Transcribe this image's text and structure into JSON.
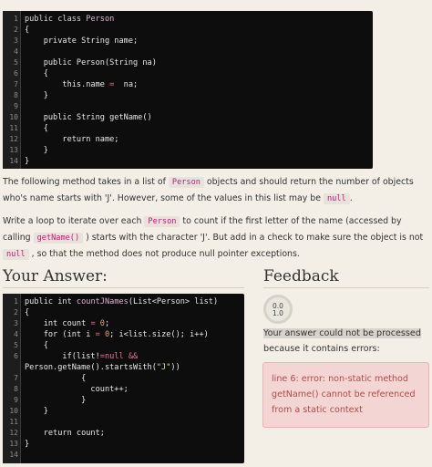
{
  "class_code": {
    "lines": [
      {
        "n": "1",
        "parts": [
          [
            "kw",
            "public class "
          ],
          [
            "cls",
            "Person"
          ]
        ]
      },
      {
        "n": "2",
        "parts": [
          [
            "",
            "{"
          ]
        ]
      },
      {
        "n": "3",
        "parts": [
          [
            "",
            "    private String name;"
          ]
        ]
      },
      {
        "n": "4",
        "parts": [
          [
            "",
            ""
          ]
        ]
      },
      {
        "n": "5",
        "parts": [
          [
            "",
            "    public Person(String na)"
          ]
        ]
      },
      {
        "n": "6",
        "parts": [
          [
            "",
            "    {"
          ]
        ]
      },
      {
        "n": "7",
        "parts": [
          [
            "",
            "        this.name "
          ],
          [
            "op",
            "="
          ],
          [
            "",
            "  na;"
          ]
        ]
      },
      {
        "n": "8",
        "parts": [
          [
            "",
            "    }"
          ]
        ]
      },
      {
        "n": "9",
        "parts": [
          [
            "",
            ""
          ]
        ]
      },
      {
        "n": "10",
        "parts": [
          [
            "",
            "    public String getName()"
          ]
        ]
      },
      {
        "n": "11",
        "parts": [
          [
            "",
            "    {"
          ]
        ]
      },
      {
        "n": "12",
        "parts": [
          [
            "",
            "        return name;"
          ]
        ]
      },
      {
        "n": "13",
        "parts": [
          [
            "",
            "    }"
          ]
        ]
      },
      {
        "n": "14",
        "parts": [
          [
            "",
            "}"
          ]
        ]
      }
    ]
  },
  "instructions": {
    "p1_a": "The following method takes in a list of ",
    "p1_tag1": "Person",
    "p1_b": " objects and should return the number of objects who's name starts with 'J'. However, some of the values in this list may be ",
    "p1_tag2": "null",
    "p1_c": ".",
    "p2_a": "Write a loop to iterate over each ",
    "p2_tag1": "Person",
    "p2_b": " to count if the first letter of the name (accessed by calling ",
    "p2_tag2": "getName()",
    "p2_c": " ) starts with the character 'J'. But add in a check to make sure the object is not ",
    "p2_tag3": "null",
    "p2_d": " , so that the method does not produce null pointer exceptions."
  },
  "answer": {
    "heading": "Your Answer:",
    "lines": [
      {
        "n": "1",
        "parts": [
          [
            "",
            "public int "
          ],
          [
            "fn",
            "countJNames"
          ],
          [
            "",
            "(List<Person> list)"
          ]
        ]
      },
      {
        "n": "2",
        "parts": [
          [
            "",
            "{"
          ]
        ]
      },
      {
        "n": "3",
        "parts": [
          [
            "",
            "    int count "
          ],
          [
            "op",
            "="
          ],
          [
            "num",
            " 0"
          ],
          [
            "",
            ";"
          ]
        ]
      },
      {
        "n": "4",
        "parts": [
          [
            "",
            "    for (int i "
          ],
          [
            "op",
            "="
          ],
          [
            "num",
            " 0"
          ],
          [
            "",
            "; i<list.size(); i++)"
          ]
        ]
      },
      {
        "n": "5",
        "parts": [
          [
            "",
            "    {"
          ]
        ]
      },
      {
        "n": "6",
        "parts": [
          [
            "",
            "        if(list!"
          ],
          [
            "op",
            "=null"
          ],
          [
            "",
            ""
          ],
          [
            "op",
            " &&"
          ]
        ]
      },
      {
        "n": "",
        "parts": [
          [
            "",
            "Person.getName().startsWith("
          ],
          [
            "str",
            "\"J\""
          ],
          [
            "",
            "))"
          ]
        ]
      },
      {
        "n": "7",
        "parts": [
          [
            "",
            "            {"
          ]
        ]
      },
      {
        "n": "8",
        "parts": [
          [
            "",
            "              count++;"
          ]
        ]
      },
      {
        "n": "9",
        "parts": [
          [
            "",
            "            }"
          ]
        ]
      },
      {
        "n": "10",
        "parts": [
          [
            "",
            "    }"
          ]
        ]
      },
      {
        "n": "11",
        "parts": [
          [
            "",
            ""
          ]
        ]
      },
      {
        "n": "12",
        "parts": [
          [
            "",
            "    return count;"
          ]
        ]
      },
      {
        "n": "13",
        "parts": [
          [
            "",
            "}"
          ]
        ]
      },
      {
        "n": "14",
        "parts": [
          [
            "",
            ""
          ]
        ]
      }
    ]
  },
  "feedback": {
    "heading": "Feedback",
    "score": "0.0",
    "score_total": "1.0",
    "msg_line1": "Your answer could not be processed",
    "msg_line2": "because it contains errors:",
    "error": "line 6: error: non-static method getName() cannot be referenced from a static context"
  }
}
